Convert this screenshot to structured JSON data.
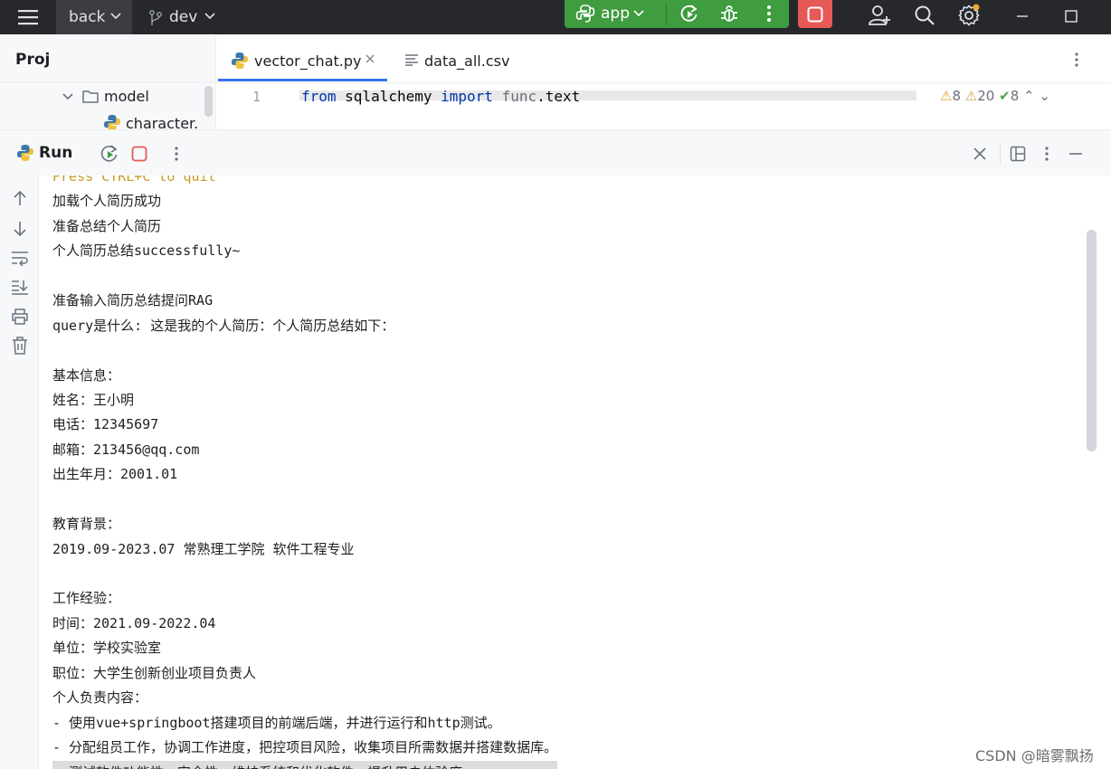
{
  "titlebar": {
    "project": "back",
    "branch": "dev",
    "run_config": "app"
  },
  "colors": {
    "titlebar_bg": "#27282c",
    "run_green": "#3f9c3f",
    "stop_red": "#e55a55",
    "accent_blue": "#3574f0",
    "keyword_blue": "#0033b3",
    "warning_yellow": "#c79a21"
  },
  "project_panel": {
    "title": "Proj",
    "tree": [
      {
        "label": "model",
        "icon": "folder-icon"
      },
      {
        "label": "character.py",
        "icon": "python-file-icon"
      }
    ]
  },
  "editor": {
    "tabs": [
      {
        "label": "vector_chat.py",
        "icon": "python-file-icon",
        "active": true,
        "closable": true
      },
      {
        "label": "data_all.csv",
        "icon": "text-file-icon",
        "active": false
      }
    ],
    "line_number": "1",
    "code": {
      "kw1": "from",
      "module": "sqlalchemy",
      "kw2": "import",
      "dim": "func",
      "rest": ".text"
    },
    "inspections": {
      "warnings": "8",
      "weak_warnings": "20",
      "ok": "8"
    }
  },
  "run_panel": {
    "title": "Run",
    "console": [
      {
        "text": "Press CTRL+C to quit",
        "style": "warn"
      },
      {
        "text": "加载个人简历成功"
      },
      {
        "text": "准备总结个人简历"
      },
      {
        "text": "个人简历总结successfully~"
      },
      {
        "text": ""
      },
      {
        "text": "准备输入简历总结提问RAG"
      },
      {
        "text": "query是什么: 这是我的个人简历：个人简历总结如下："
      },
      {
        "text": ""
      },
      {
        "text": "基本信息："
      },
      {
        "text": "姓名：王小明"
      },
      {
        "text": "电话：12345697"
      },
      {
        "text": "邮箱：213456@qq.com"
      },
      {
        "text": "出生年月：2001.01"
      },
      {
        "text": ""
      },
      {
        "text": "教育背景："
      },
      {
        "text": "2019.09-2023.07 常熟理工学院 软件工程专业"
      },
      {
        "text": ""
      },
      {
        "text": "工作经验："
      },
      {
        "text": "时间：2021.09-2022.04"
      },
      {
        "text": "单位：学校实验室"
      },
      {
        "text": "职位：大学生创新创业项目负责人"
      },
      {
        "text": "个人负责内容："
      },
      {
        "text": "- 使用vue+springboot搭建项目的前端后端，并进行运行和http测试。"
      },
      {
        "text": "- 分配组员工作，协调工作进度，把控项目风险，收集项目所需数据并搭建数据库。"
      },
      {
        "text": "- 测试软件功能性、安全性，维护系统和优化软件，提升用户体验度。",
        "style": "sel"
      }
    ]
  },
  "watermark": "CSDN @暗雾飘扬"
}
